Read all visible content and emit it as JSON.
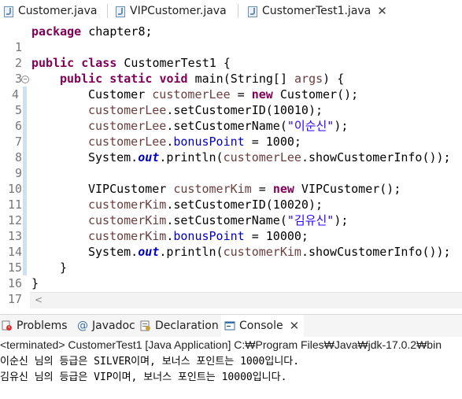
{
  "editor_tabs": [
    {
      "label": "Customer.java",
      "active": false
    },
    {
      "label": "VIPCustomer.java",
      "active": false
    },
    {
      "label": "CustomerTest1.java",
      "active": true
    }
  ],
  "code_lines": [
    {
      "num": "1"
    },
    {
      "num": "2"
    },
    {
      "num": "3"
    },
    {
      "num": "4"
    },
    {
      "num": "5"
    },
    {
      "num": "6"
    },
    {
      "num": "7"
    },
    {
      "num": "8"
    },
    {
      "num": "9"
    },
    {
      "num": "10"
    },
    {
      "num": "11"
    },
    {
      "num": "12"
    },
    {
      "num": "13"
    },
    {
      "num": "14"
    },
    {
      "num": "15"
    },
    {
      "num": "16"
    },
    {
      "num": "17"
    }
  ],
  "code": {
    "l1_kw": "package",
    "l1_rest": " chapter8;",
    "l3_kw1": "public",
    "l3_kw2": "class",
    "l3_rest": " CustomerTest1 {",
    "l4_kw1": "public",
    "l4_kw2": "static",
    "l4_kw3": "void",
    "l4_rest1": " main(String[] ",
    "l4_arg": "args",
    "l4_rest2": ") {",
    "l5_type": "Customer ",
    "l5_var": "customerLee",
    "l5_eq": " = ",
    "l5_kw": "new",
    "l5_rest": " Customer();",
    "l6_var": "customerLee",
    "l6_rest": ".setCustomerID(10010);",
    "l7_var": "customerLee",
    "l7_rest1": ".setCustomerName(",
    "l7_str": "\"이순신\"",
    "l7_rest2": ");",
    "l8_var": "customerLee",
    "l8_dot": ".",
    "l8_fld": "bonusPoint",
    "l8_rest": " = 1000;",
    "l9_pre": "System.",
    "l9_out": "out",
    "l9_mid": ".println(",
    "l9_var": "customerLee",
    "l9_rest": ".showCustomerInfo());",
    "l11_type": "VIPCustomer ",
    "l11_var": "customerKim",
    "l11_eq": " = ",
    "l11_kw": "new",
    "l11_rest": " VIPCustomer();",
    "l12_var": "customerKim",
    "l12_rest": ".setCustomerID(10020);",
    "l13_var": "customerKim",
    "l13_rest1": ".setCustomerName(",
    "l13_str": "\"김유신\"",
    "l13_rest2": ");",
    "l14_var": "customerKim",
    "l14_dot": ".",
    "l14_fld": "bonusPoint",
    "l14_rest": " = 10000;",
    "l15_pre": "System.",
    "l15_out": "out",
    "l15_mid": ".println(",
    "l15_var": "customerKim",
    "l15_rest": ".showCustomerInfo());",
    "l16": "}",
    "l17": "}"
  },
  "view_tabs": [
    {
      "label": "Problems",
      "icon": "problems-icon"
    },
    {
      "label": "Javadoc",
      "icon": "at-icon"
    },
    {
      "label": "Declaration",
      "icon": "declaration-icon"
    },
    {
      "label": "Console",
      "icon": "console-icon",
      "active": true
    }
  ],
  "console": {
    "terminated": "<terminated> CustomerTest1 [Java Application] C:₩Program Files₩Java₩jdk-17.0.2₩bin",
    "output": [
      "이순신 님의 등급은 SILVER이며, 보너스 포인트는 1000입니다.",
      "김유신 님의 등급은 VIP이며, 보너스 포인트는 10000입니다."
    ]
  },
  "colors": {
    "keyword": "#7f0055",
    "variable": "#6a3e3e",
    "field": "#0000c0",
    "string": "#2a00ff",
    "line_number": "#787878",
    "change_marker": "#cfe0f3"
  }
}
